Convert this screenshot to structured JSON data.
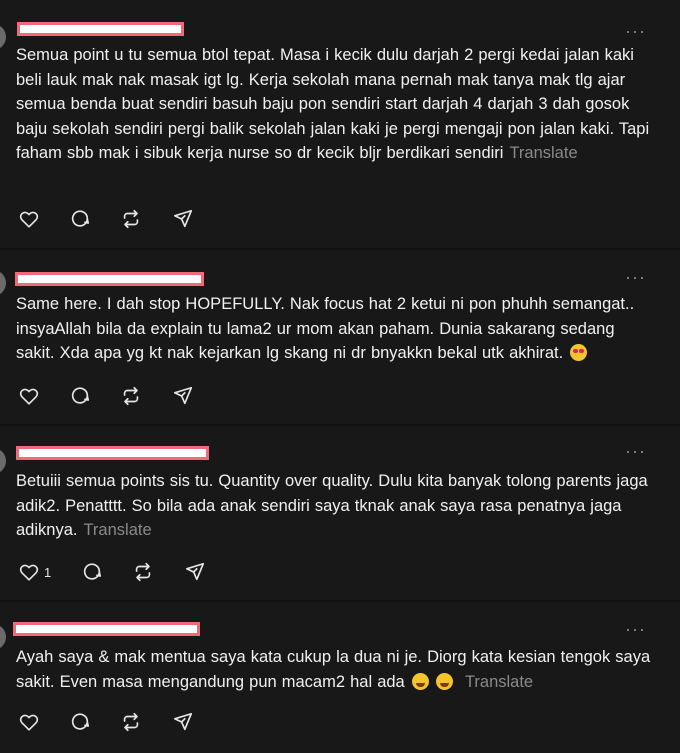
{
  "icons": {
    "more": "more-horizontal-icon",
    "like": "heart-icon",
    "comment": "comment-bubble-icon",
    "repost": "repost-icon",
    "share": "send-icon"
  },
  "colors": {
    "background": "#101010",
    "card": "#181818",
    "text": "#f1f1f1",
    "muted": "#8a8a8a",
    "redaction_border": "#f06a7a"
  },
  "posts": [
    {
      "more": "···",
      "text": "Semua point u tu semua btol tepat. Masa i kecik dulu darjah 2 pergi kedai jalan kaki beli lauk mak nak masak igt lg. Kerja sekolah mana pernah mak tanya mak tlg ajar semua benda buat sendiri basuh baju pon sendiri start darjah 4 darjah 3 dah gosok baju sekolah sendiri pergi balik sekolah jalan kaki je pergi mengaji pon jalan kaki. Tapi faham sbb mak i sibuk kerja nurse so dr kecik bljr berdikari sendiri",
      "translate": "Translate",
      "like_count": ""
    },
    {
      "more": "···",
      "text": "Same here. I dah stop HOPEFULLY. Nak focus hat 2 ketui ni pon phuhh semangat.. insyaAllah bila da explain tu lama2 ur mom akan paham. Dunia sakarang sedang sakit. Xda apa yg kt nak kejarkan lg skang ni dr bnyakkn bekal utk akhirat.",
      "translate": "",
      "like_count": ""
    },
    {
      "more": "···",
      "text": "Betuiii semua points sis tu. Quantity over quality. Dulu kita banyak tolong parents jaga adik2. Penatttt. So bila ada anak sendiri saya tknak anak saya rasa penatnya jaga adiknya.",
      "translate": "Translate",
      "like_count": "1"
    },
    {
      "more": "···",
      "text": "Ayah saya & mak mentua saya kata cukup la dua ni je. Diorg kata kesian tengok saya sakit. Even masa mengandung pun macam2 hal ada",
      "translate": "Translate",
      "like_count": ""
    }
  ]
}
